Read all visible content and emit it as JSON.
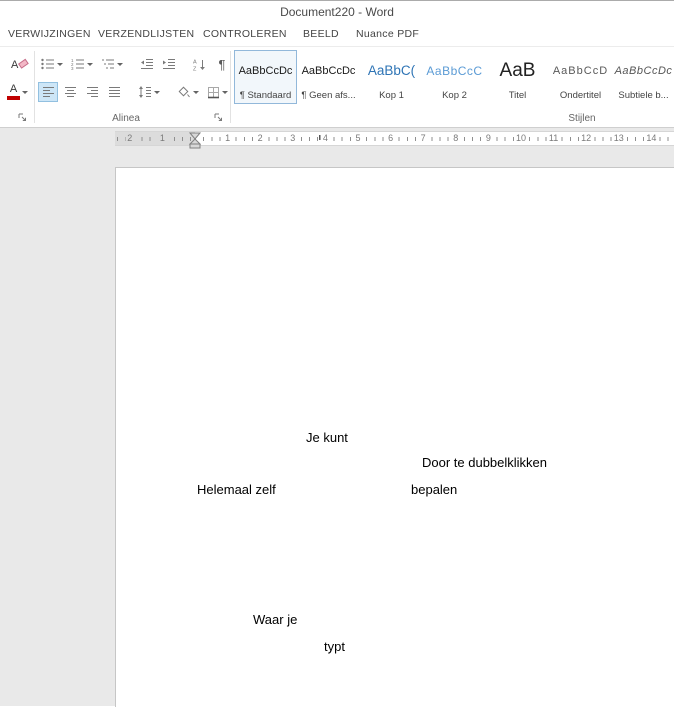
{
  "window": {
    "title": "Document220 - Word"
  },
  "tabs": [
    {
      "label": "VERWIJZINGEN"
    },
    {
      "label": "VERZENDLIJSTEN"
    },
    {
      "label": "CONTROLEREN"
    },
    {
      "label": "BEELD"
    },
    {
      "label": "Nuance PDF"
    }
  ],
  "ribbon": {
    "paragraph_group": {
      "label": "Alinea"
    },
    "styles_group": {
      "label": "Stijlen",
      "gallery": [
        {
          "sample": "AaBbCcDc",
          "name": "¶ Standaard",
          "selected": true
        },
        {
          "sample": "AaBbCcDc",
          "name": "¶ Geen afs...",
          "selected": false
        },
        {
          "sample": "AaBbC(",
          "name": "Kop 1",
          "selected": false
        },
        {
          "sample": "AaBbCcC",
          "name": "Kop 2",
          "selected": false
        },
        {
          "sample": "AaB",
          "name": "Titel",
          "selected": false
        },
        {
          "sample": "AaBbCcD",
          "name": "Ondertitel",
          "selected": false
        },
        {
          "sample": "AaBbCcDc",
          "name": "Subtiele b...",
          "selected": false
        }
      ]
    }
  },
  "icons": {
    "pilcrow": "¶",
    "font_color_letter": "A",
    "clear_format_letter": "A"
  },
  "colors": {
    "font_color_bar": "#c00000",
    "heading1_blue": "#2e74b5",
    "heading2_blue": "#5b9bd5",
    "active_toggle_bg": "#cde6f7"
  },
  "ruler": {
    "margin_numbers": [
      "2",
      "1"
    ],
    "page_numbers": [
      "1",
      "2",
      "3",
      "4",
      "5",
      "6",
      "7",
      "8",
      "9",
      "10",
      "11",
      "12",
      "13",
      "14"
    ]
  },
  "document": {
    "texts": [
      "Je kunt",
      "Door te dubbelklikken",
      "Helemaal zelf",
      "bepalen",
      "Waar je",
      "typt"
    ]
  }
}
